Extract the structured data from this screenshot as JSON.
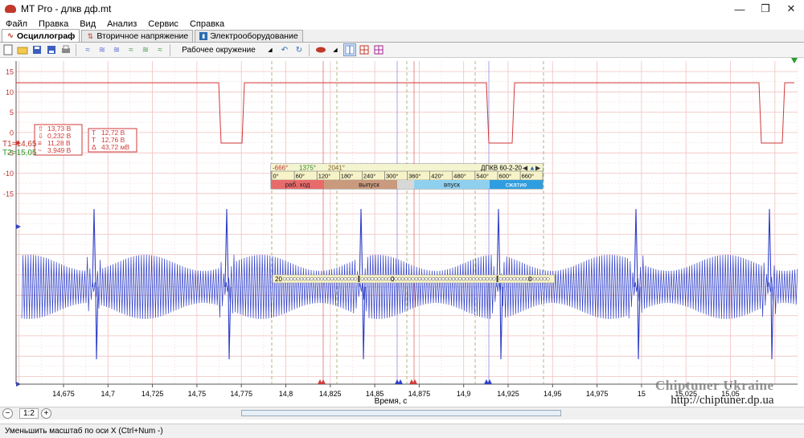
{
  "window": {
    "title": "MT Pro - длкв дф.mt"
  },
  "menu": [
    "Файл",
    "Правка",
    "Вид",
    "Анализ",
    "Сервис",
    "Справка"
  ],
  "tabs": [
    {
      "label": "Осциллограф",
      "icon": "wave-icon",
      "active": true
    },
    {
      "label": "Вторичное напряжение",
      "icon": "coil-icon",
      "active": false
    },
    {
      "label": "Электрооборудование",
      "icon": "battery-icon",
      "active": false
    }
  ],
  "toolbar": {
    "environment_label": "Рабочее окружение"
  },
  "plot": {
    "y_ticks": [
      15,
      10,
      5,
      0,
      -5,
      -10,
      -15
    ],
    "x_ticks": [
      "14,675",
      "14,7",
      "14,725",
      "14,75",
      "14,775",
      "14,8",
      "14,825",
      "14,85",
      "14,875",
      "14,9",
      "14,925",
      "14,95",
      "14,975",
      "15",
      "15,025",
      "15,05"
    ],
    "x_axis_label": "Время, с",
    "t1_label": "T1=14,65",
    "t2_label": "T2=15,05",
    "colors": {
      "red_channel": "#d03a3a",
      "blue_channel": "#2f3fc8",
      "grid": "#f0b8b8"
    }
  },
  "measure_box_1": {
    "max": "13,73 В",
    "min": "0,232 В",
    "avg": "11,28 В",
    "rms": "3,949 В"
  },
  "measure_box_2": {
    "t1": "12,72 В",
    "t2": "12,76 В",
    "delta": "43,72 мВ"
  },
  "dpkv": {
    "angle1": "-666°",
    "angle2": "1375°",
    "angle_delta": "2041°",
    "sensor": "ДПКВ 60-2-20",
    "scale_ticks": [
      "0°",
      "60°",
      "120°",
      "180°",
      "240°",
      "300°",
      "360°",
      "420°",
      "480°",
      "540°",
      "600°",
      "660°"
    ],
    "phases": [
      {
        "label": "раб. ход",
        "color": "#e86b6b"
      },
      {
        "label": "выпуск",
        "color": "#c99a7d"
      },
      {
        "label": "впуск",
        "color": "#8fd0ef"
      },
      {
        "label": "сжатие",
        "color": "#2f9ee0"
      }
    ]
  },
  "tooth_strip": {
    "left": "20",
    "middle": "0",
    "right": "0"
  },
  "bottom": {
    "zoom_ratio": "1:2"
  },
  "status": {
    "text": "Уменьшить масштаб по оси X (Ctrl+Num -)"
  },
  "watermark": {
    "line1": "Chiptuner Ukraine",
    "line2": "http://chiptuner.dp.ua"
  }
}
